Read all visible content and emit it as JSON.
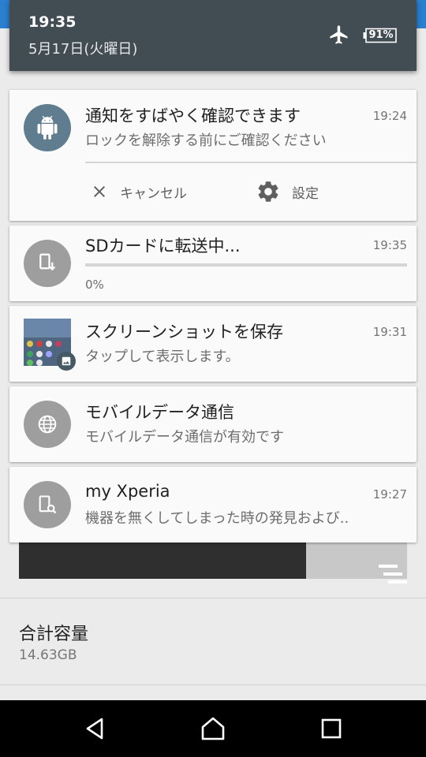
{
  "status": {
    "time": "19:35",
    "date": "5月17日(火曜日)",
    "battery": "91%"
  },
  "notifications": {
    "android": {
      "title": "通知をすばやく確認できます",
      "text": "ロックを解除する前にご確認ください",
      "time": "19:24",
      "actions": {
        "cancel": "キャンセル",
        "settings": "設定"
      }
    },
    "sd": {
      "title": "SDカードに転送中...",
      "time": "19:35",
      "progress_text": "0%",
      "progress": 0
    },
    "screenshot": {
      "title": "スクリーンショットを保存",
      "text": "タップして表示します。",
      "time": "19:31"
    },
    "mobile_data": {
      "title": "モバイルデータ通信",
      "text": "モバイルデータ通信が有効です"
    },
    "xperia": {
      "title": "my Xperia",
      "text": "機器を無くしてしまった時の発見および..",
      "time": "19:27"
    }
  },
  "background": {
    "total_label": "合計容量",
    "total_value": "14.63GB"
  },
  "colors": {
    "header": "#424c53",
    "card": "#fafafa",
    "android_icon": "#5f7d8e",
    "icon_gray": "#9e9e9e",
    "nav": "#000000"
  }
}
